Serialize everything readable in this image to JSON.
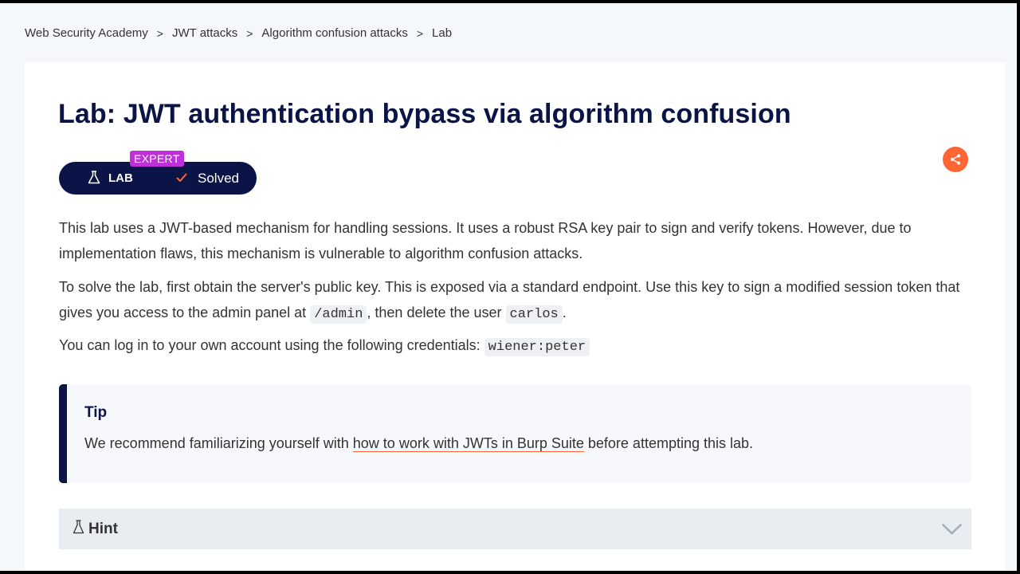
{
  "breadcrumb": [
    {
      "label": "Web Security Academy"
    },
    {
      "label": "JWT attacks"
    },
    {
      "label": "Algorithm confusion attacks"
    },
    {
      "label": "Lab"
    }
  ],
  "breadcrumb_separator": ">",
  "title": "Lab: JWT authentication bypass via algorithm confusion",
  "lab_badge": {
    "level": "EXPERT",
    "lab_label": "LAB",
    "status": "Solved",
    "flask_icon": "flask-icon",
    "check_icon": "check-icon"
  },
  "share": {
    "icon": "share-icon"
  },
  "description": {
    "p1": "This lab uses a JWT-based mechanism for handling sessions. It uses a robust RSA key pair to sign and verify tokens. However, due to implementation flaws, this mechanism is vulnerable to algorithm confusion attacks.",
    "p2_part1": "To solve the lab, first obtain the server's public key. This is exposed via a standard endpoint. Use this key to sign a modified session token that gives you access to the admin panel at ",
    "p2_code1": "/admin",
    "p2_part2": ", then delete the user ",
    "p2_code2": "carlos",
    "p2_part3": ".",
    "p3_part1": "You can log in to your own account using the following credentials: ",
    "p3_code": "wiener:peter"
  },
  "tip": {
    "title": "Tip",
    "text_before": "We recommend familiarizing yourself with ",
    "link_text": "how to work with JWTs in Burp Suite",
    "text_after": " before attempting this lab."
  },
  "hint": {
    "label": "Hint",
    "icon": "flask-icon",
    "toggle_icon": "chevron-down-icon"
  },
  "colors": {
    "navy": "#0a1446",
    "orange": "#ff6633",
    "expert_purple": "#c030d8",
    "page_bg": "#f5f8fb",
    "hint_bg": "#e8edf1"
  }
}
